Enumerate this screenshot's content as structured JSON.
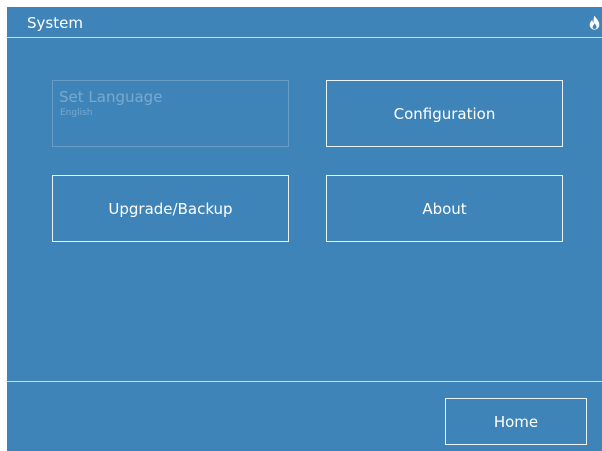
{
  "header": {
    "title": "System",
    "icon": "flame-icon"
  },
  "tiles": [
    {
      "label": "Set Language",
      "sublabel": "English",
      "enabled": false
    },
    {
      "label": "Configuration",
      "enabled": true
    },
    {
      "label": "Upgrade/Backup",
      "enabled": true
    },
    {
      "label": "About",
      "enabled": true
    }
  ],
  "footer": {
    "home_label": "Home"
  },
  "colors": {
    "background": "#3f84b9",
    "text": "#ffffff",
    "border": "#e9f2f9",
    "disabled": "#7aa9cf"
  }
}
